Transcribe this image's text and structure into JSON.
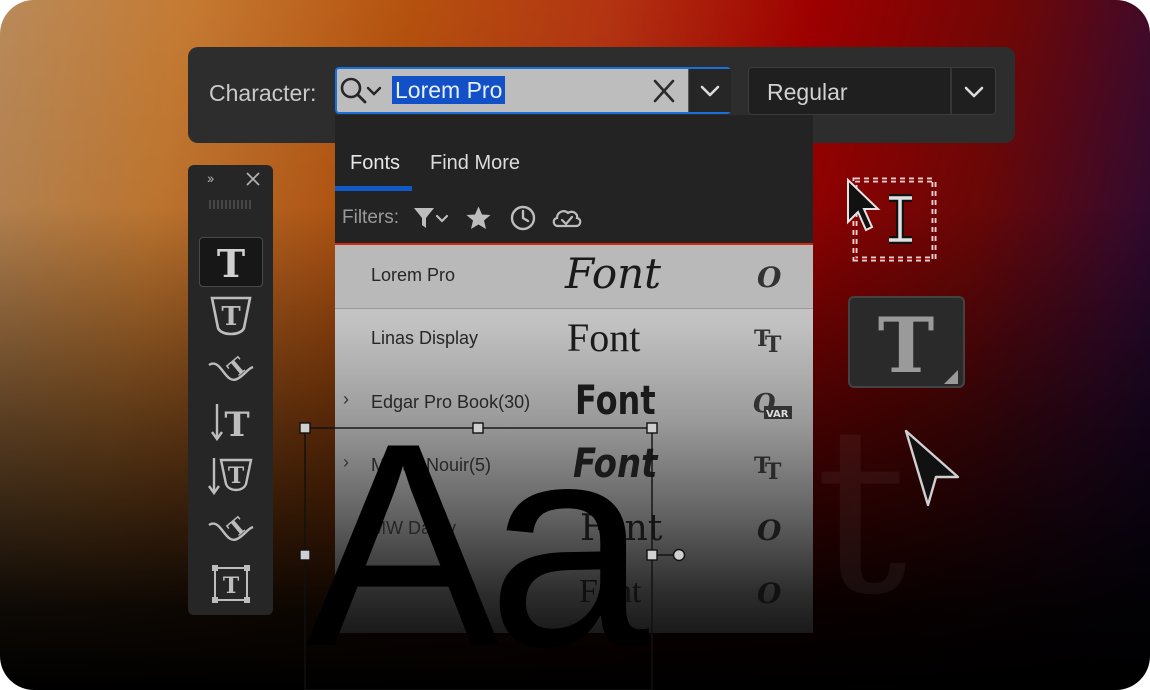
{
  "character_bar": {
    "label": "Character:",
    "search": {
      "value": "Lorem Pro"
    },
    "style": {
      "value": "Regular"
    }
  },
  "dropdown": {
    "tabs": [
      {
        "label": "Fonts",
        "active": true
      },
      {
        "label": "Find More",
        "active": false
      }
    ],
    "filters_label": "Filters:",
    "filter_icons": [
      "funnel-icon",
      "star-icon",
      "clock-icon",
      "cloud-check-icon"
    ],
    "fonts": [
      {
        "name": "Lorem Pro",
        "sample": "Font",
        "expandable": false,
        "type_icon": "opentype-icon"
      },
      {
        "name": "Linas Display",
        "sample": "Font",
        "expandable": false,
        "type_icon": "truetype-icon"
      },
      {
        "name": "Edgar Pro Book(30)",
        "sample": "Font",
        "expandable": true,
        "type_icon": "variable-font-icon",
        "type_badge": "VAR"
      },
      {
        "name": "Martin Nouir(5)",
        "sample": "Font",
        "expandable": true,
        "type_icon": "truetype-icon"
      },
      {
        "name": "MW Darby",
        "sample": "Font",
        "expandable": false,
        "type_icon": "opentype-icon"
      },
      {
        "name": "",
        "sample": "Font",
        "expandable": false,
        "type_icon": "opentype-icon"
      }
    ]
  },
  "tools_panel": {
    "tools": [
      "horizontal-type-tool",
      "horizontal-type-mask-tool",
      "type-on-path-tool",
      "vertical-type-tool",
      "vertical-type-mask-tool",
      "vertical-type-on-path-tool",
      "area-type-tool"
    ]
  },
  "canvas": {
    "sample_text": "Aa",
    "background_glyph": "t"
  },
  "colors": {
    "accent": "#1159c7",
    "selection": "#1150c6",
    "panel": "#2d2d2d",
    "highlight_line": "#d3280d"
  }
}
